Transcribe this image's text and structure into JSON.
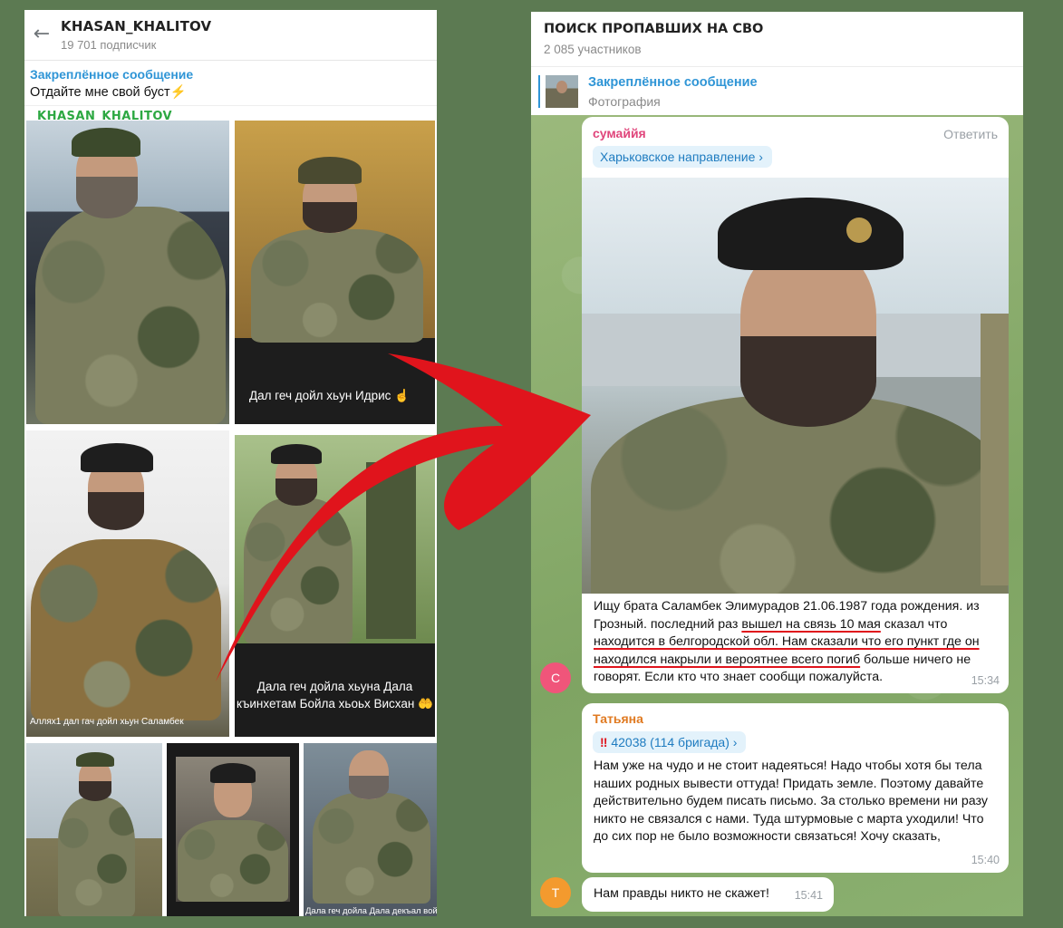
{
  "left_panel": {
    "channel_name": "KHASAN_KHALITOV",
    "subscribers": "19 701 подписчик",
    "pinned_title": "Закреплённое сообщение",
    "pinned_text": "Отдайте мне свой буст",
    "watermark": "KHASAN_KHALITOV",
    "captions": {
      "photo2": "Дал геч дойл хьун Идрис",
      "photo3": "Аллях1 дал гач дойл хьун Саламбек",
      "photo4_line1": "Дала геч дойла хьуна Дала",
      "photo4_line2": "къинхетам Бойла хьоьх Висхан",
      "photo7": "Дала геч дойла Дала декъал войла Дала"
    },
    "icons": [
      "back-arrow-icon",
      "lightning-icon",
      "hand-emoji-icon",
      "palms-emoji-icon"
    ]
  },
  "right_panel": {
    "group_name": "ПОИСК ПРОПАВШИХ НА СВО",
    "members": "2 085 участников",
    "pinned_title": "Закреплённое сообщение",
    "pinned_sub": "Фотография",
    "messages": [
      {
        "author": "сумаййя",
        "author_color": "#e0457b",
        "reply_label": "Ответить",
        "topic": "Харьковское направление",
        "text_part1": "Ищу брата Саламбек Элимурадов 21.06.1987 года рождения. из Грозный. последний раз ",
        "text_underlined1": "вышел на связь 10 мая",
        "text_part2": " сказал что ",
        "text_underlined2": "находится в белгородской обл. Нам сказали что его пункт где он находился накрыли и вероятнее всего погиб",
        "text_part3": " больше ничего не говорят. Если кто что знает сообщи пожалуйста.",
        "time": "15:34",
        "avatar_letter": "С",
        "avatar_color": "#f0557a"
      },
      {
        "author": "Татьяна",
        "author_color": "#e07a21",
        "topic": "42038 (114 бригада)",
        "text": "Нам уже на чудо и не стоит надеяться! Надо чтобы хотя бы тела наших родных вывести оттуда! Придать земле. Поэтому давайте действительно будем писать письмо. За столько времени ни разу никто не связался с нами. Туда штурмовые с марта уходили! Что до сих пор не было возможности связаться! Хочу сказать,",
        "time": "15:40"
      },
      {
        "text": "Нам правды никто не скажет!",
        "time": "15:41",
        "avatar_letter": "Т",
        "avatar_color": "#f39a2e"
      }
    ]
  },
  "colors": {
    "background": "#5c7a52",
    "link_blue": "#2f95d6",
    "arrow_red": "#e0141c",
    "underline_red": "#e0141c"
  }
}
